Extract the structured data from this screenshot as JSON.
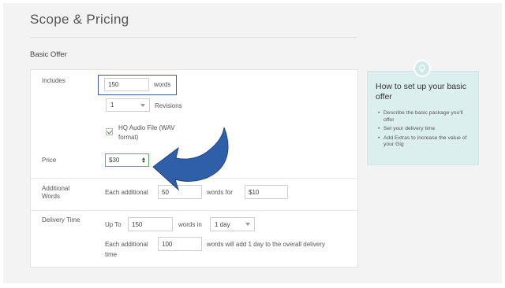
{
  "header": {
    "title": "Scope & Pricing"
  },
  "section": {
    "label": "Basic Offer"
  },
  "includes": {
    "label": "Includes",
    "words_value": "150",
    "words_unit": "words",
    "revisions_value": "1",
    "revisions_label": "Revisions",
    "hq_audio_label": "HQ Audio File (WAV format)",
    "hq_audio_checked": true
  },
  "price": {
    "label": "Price",
    "value": "$30"
  },
  "additional_words": {
    "label": "Additional Words",
    "each_label": "Each additional",
    "words_value": "50",
    "words_for_label": "words for",
    "price_value": "$10"
  },
  "delivery": {
    "label": "Delivery Time",
    "up_to_label": "Up To",
    "words_value": "150",
    "words_in_label": "words in",
    "days_value": "1 day",
    "each_label": "Each additional",
    "each_label_line2": "time",
    "additional_value": "100",
    "additional_suffix": "words will add 1 day to the overall delivery"
  },
  "help": {
    "title": "How to set up your basic offer",
    "items": [
      "Describe the basic package you'll offer",
      "Set your delivery time",
      "Add Extras to increase the value of your Gig"
    ]
  },
  "icons": {
    "help": "lightbulb-icon",
    "pointer": "curved-arrow-icon",
    "checkbox": "checkmark-icon"
  },
  "colors": {
    "highlight_border": "#3c5aa6",
    "price_border": "#5cb85c",
    "arrow": "#2f5fa8",
    "help_bg": "#dcefef"
  }
}
